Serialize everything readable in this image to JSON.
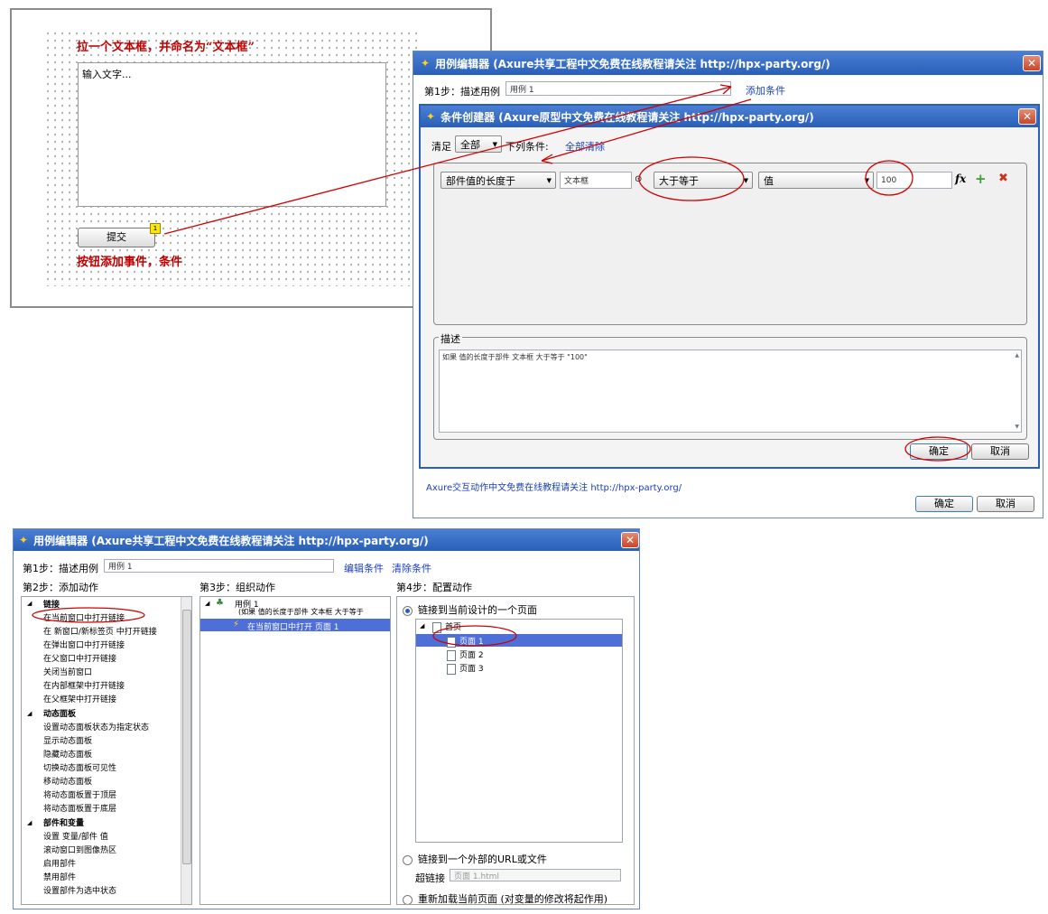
{
  "canvas": {
    "instruction_top": "拉一个文本框，并命名为“文本框”",
    "textarea_placeholder": "输入文字...",
    "submit_button": "提交",
    "note_badge": "1",
    "instruction_bottom": "按钮添加事件，条件"
  },
  "case_editor_top": {
    "title": "用例编辑器 (Axure共享工程中文免费在线教程请关注 http://hpx-party.org/)",
    "step1_label": "第1步：描述用例",
    "case_name": "用例 1",
    "add_condition_link": "添加条件",
    "footer_text": "Axure交互动作中文免费在线教程请关注 http://hpx-party.org/",
    "ok": "确定",
    "cancel": "取消"
  },
  "condition_builder": {
    "title": "条件创建器 (Axure原型中文免费在线教程请关注 http://hpx-party.org/)",
    "satisfy_label": "清足",
    "match_select": "全部",
    "following_label": "下列条件:",
    "clear_all_link": "全部清除",
    "condition": {
      "type": "部件值的长度于",
      "widget": "文本框",
      "operator": "大于等于",
      "value_type": "值",
      "value": "100"
    },
    "description_label": "描述",
    "description_text": "如果 值的长度于部件 文本框 大于等于 \"100\"",
    "ok": "确定",
    "cancel": "取消"
  },
  "case_editor_bottom": {
    "title": "用例编辑器 (Axure共享工程中文免费在线教程请关注 http://hpx-party.org/)",
    "step1_label": "第1步：描述用例",
    "case_name": "用例 1",
    "edit_condition_link": "编辑条件",
    "clear_condition_link": "清除条件",
    "step2_label": "第2步：添加动作",
    "step3_label": "第3步：组织动作",
    "step4_label": "第4步：配置动作",
    "actions": [
      {
        "label": "链接",
        "category": true
      },
      {
        "label": "在当前窗口中打开链接"
      },
      {
        "label": "在 新窗口/新标签页 中打开链接"
      },
      {
        "label": "在弹出窗口中打开链接"
      },
      {
        "label": "在父窗口中打开链接"
      },
      {
        "label": "关闭当前窗口"
      },
      {
        "label": "在内部框架中打开链接"
      },
      {
        "label": "在父框架中打开链接"
      },
      {
        "label": "动态面板",
        "category": true
      },
      {
        "label": "设置动态面板状态为指定状态"
      },
      {
        "label": "显示动态面板"
      },
      {
        "label": "隐藏动态面板"
      },
      {
        "label": "切换动态面板可见性"
      },
      {
        "label": "移动动态面板"
      },
      {
        "label": "将动态面板置于顶层"
      },
      {
        "label": "将动态面板置于底层"
      },
      {
        "label": "部件和变量",
        "category": true
      },
      {
        "label": "设置 变量/部件 值"
      },
      {
        "label": "滚动窗口到图像热区"
      },
      {
        "label": "启用部件"
      },
      {
        "label": "禁用部件"
      },
      {
        "label": "设置部件为选中状态"
      }
    ],
    "organize": {
      "case": "用例 1",
      "case_condition": "(如果 值的长度于部件 文本框 大于等于",
      "action": "在当前窗口中打开 页面 1"
    },
    "config": {
      "option1": "链接到当前设计的一个页面",
      "pages": [
        "首页",
        "页面 1",
        "页面 2",
        "页面 3"
      ],
      "option2": "链接到一个外部的URL或文件",
      "hyperlink_label": "超链接",
      "hyperlink_value": "页面 1.html",
      "option3": "重新加载当前页面 (对变量的修改将起作用)"
    }
  },
  "colors": {
    "title_blue": "#2a5fb8",
    "annotation_red": "#c00000",
    "selection_blue": "#4f6fd8"
  }
}
